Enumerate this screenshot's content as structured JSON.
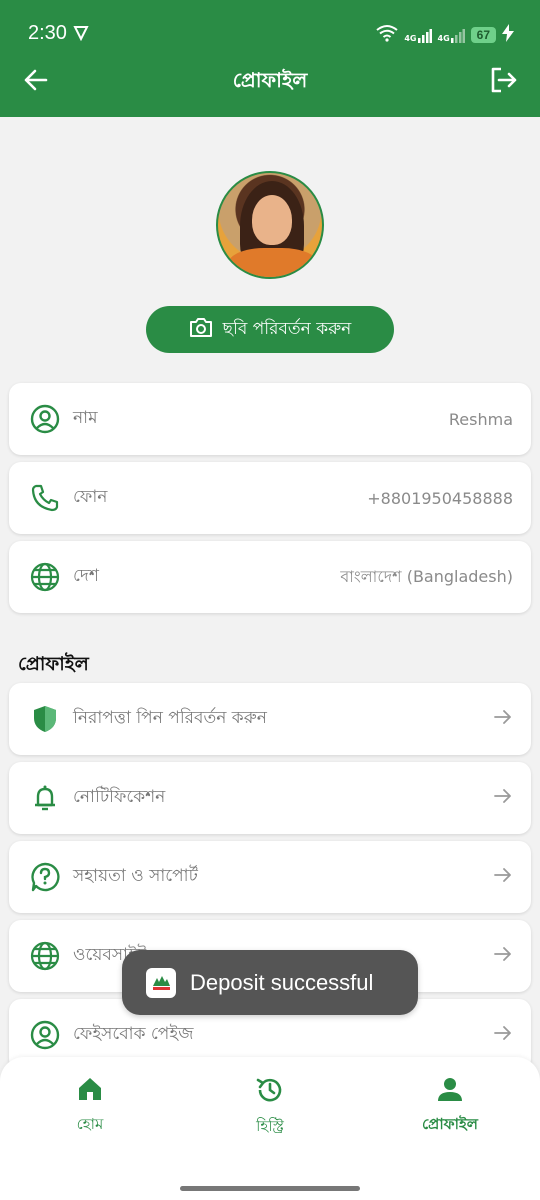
{
  "status_bar": {
    "time": "2:30",
    "network_1": "4G",
    "network_2": "4G",
    "battery": "67"
  },
  "header": {
    "title": "প্রোফাইল"
  },
  "profile": {
    "change_photo_label": "ছবি পরিবর্তন করুন"
  },
  "info": [
    {
      "label": "নাম",
      "value": "Reshma",
      "icon": "person-circle-icon"
    },
    {
      "label": "ফোন",
      "value": "+8801950458888",
      "icon": "phone-icon"
    },
    {
      "label": "দেশ",
      "value": "বাংলাদেশ (Bangladesh)",
      "icon": "globe-icon"
    }
  ],
  "section": {
    "title": "প্রোফাইল"
  },
  "menu": [
    {
      "label": "নিরাপত্তা পিন পরিবর্তন করুন",
      "icon": "shield-icon"
    },
    {
      "label": "নোটিফিকেশন",
      "icon": "bell-icon"
    },
    {
      "label": "সহায়তা ও সাপোর্ট",
      "icon": "help-circle-icon"
    },
    {
      "label": "ওয়েবসাইট",
      "icon": "globe-icon"
    },
    {
      "label": "ফেইসবোক পেইজ",
      "icon": "person-circle-icon"
    }
  ],
  "toast": {
    "message": "Deposit successful"
  },
  "bottom_nav": [
    {
      "label": "হোম",
      "icon": "home-icon"
    },
    {
      "label": "হিস্ট্রি",
      "icon": "history-icon"
    },
    {
      "label": "প্রোফাইল",
      "icon": "person-icon"
    }
  ],
  "colors": {
    "primary": "#2a8c45",
    "background": "#f2f2f2",
    "toast": "#555555"
  }
}
